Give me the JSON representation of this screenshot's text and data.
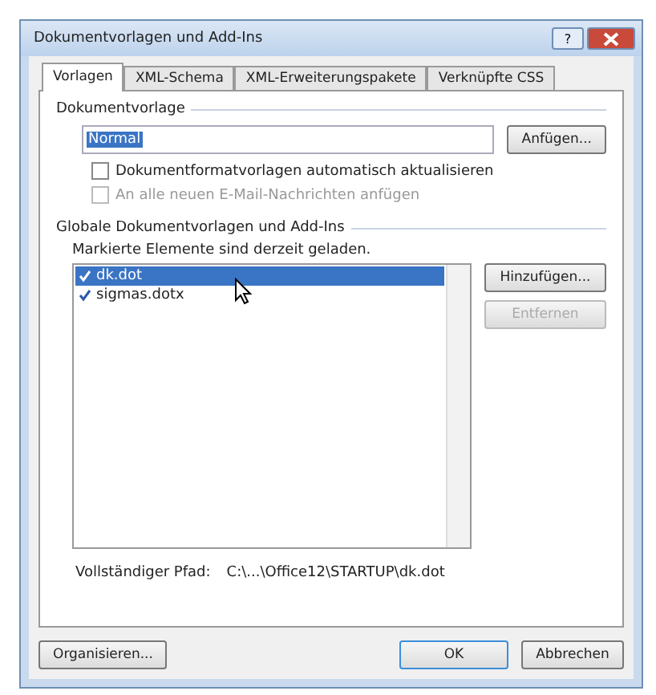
{
  "window": {
    "title": "Dokumentvorlagen und Add-Ins",
    "help_button": "?"
  },
  "tabs": [
    {
      "label": "Vorlagen",
      "selected": true
    },
    {
      "label": "XML-Schema",
      "selected": false
    },
    {
      "label": "XML-Erweiterungspakete",
      "selected": false
    },
    {
      "label": "Verknüpfte CSS",
      "selected": false
    }
  ],
  "template": {
    "heading": "Dokumentvorlage",
    "value": "Normal",
    "attach_button": "Anfügen...",
    "options": [
      {
        "label": "Dokumentformatvorlagen automatisch aktualisieren",
        "checked": false,
        "disabled": false
      },
      {
        "label": "An alle neuen E-Mail-Nachrichten anfügen",
        "checked": false,
        "disabled": true
      }
    ]
  },
  "global": {
    "heading": "Globale Dokumentvorlagen und Add-Ins",
    "note": "Markierte Elemente sind derzeit geladen.",
    "items": [
      {
        "label": "dk.dot",
        "checked": true,
        "selected": true
      },
      {
        "label": "sigmas.dotx",
        "checked": true,
        "selected": false
      }
    ],
    "buttons": [
      {
        "label": "Hinzufügen...",
        "disabled": false
      },
      {
        "label": "Entfernen",
        "disabled": true
      }
    ],
    "path_label": "Vollständiger Pfad:",
    "path": "C:\\...\\Office12\\STARTUP\\dk.dot"
  },
  "footer": {
    "organize_button": "Organisieren...",
    "ok_button": "OK",
    "cancel_button": "Abbrechen"
  }
}
